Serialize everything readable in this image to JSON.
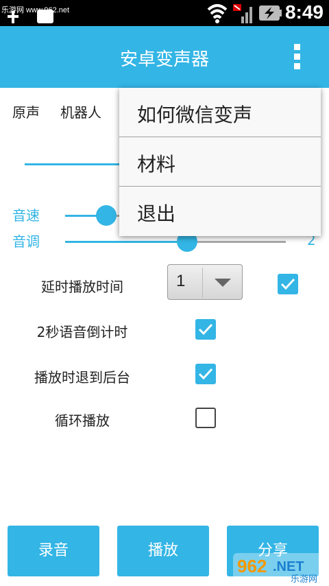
{
  "status_bar": {
    "watermark": "乐游网 www.962.net",
    "time": "8:49",
    "icons": [
      "usb-icon",
      "sd-card-icon",
      "wifi-icon",
      "no-sim-icon",
      "signal-icon",
      "battery-charging-icon"
    ]
  },
  "action_bar": {
    "title": "安卓变声器",
    "overflow_icon": "overflow-menu-icon",
    "color": "#33b5e5"
  },
  "tabs": [
    "原声",
    "机器人"
  ],
  "sliders": [
    {
      "label": "音速",
      "value": null
    },
    {
      "label": "音调",
      "value": "2"
    }
  ],
  "settings": {
    "delay": {
      "label": "延时播放时间",
      "spinner_value": "1",
      "checked": true
    },
    "countdown": {
      "label": "2秒语音倒计时",
      "checked": true
    },
    "background": {
      "label": "播放时退到后台",
      "checked": true
    },
    "loop": {
      "label": "循环播放",
      "checked": false
    }
  },
  "buttons": {
    "record": "录音",
    "play": "播放",
    "share": "分享"
  },
  "overflow_menu": {
    "items": [
      "如何微信变声",
      "材料",
      "退出"
    ]
  },
  "watermark_bottom": {
    "brand": "962.NET",
    "sub": "乐游网"
  }
}
